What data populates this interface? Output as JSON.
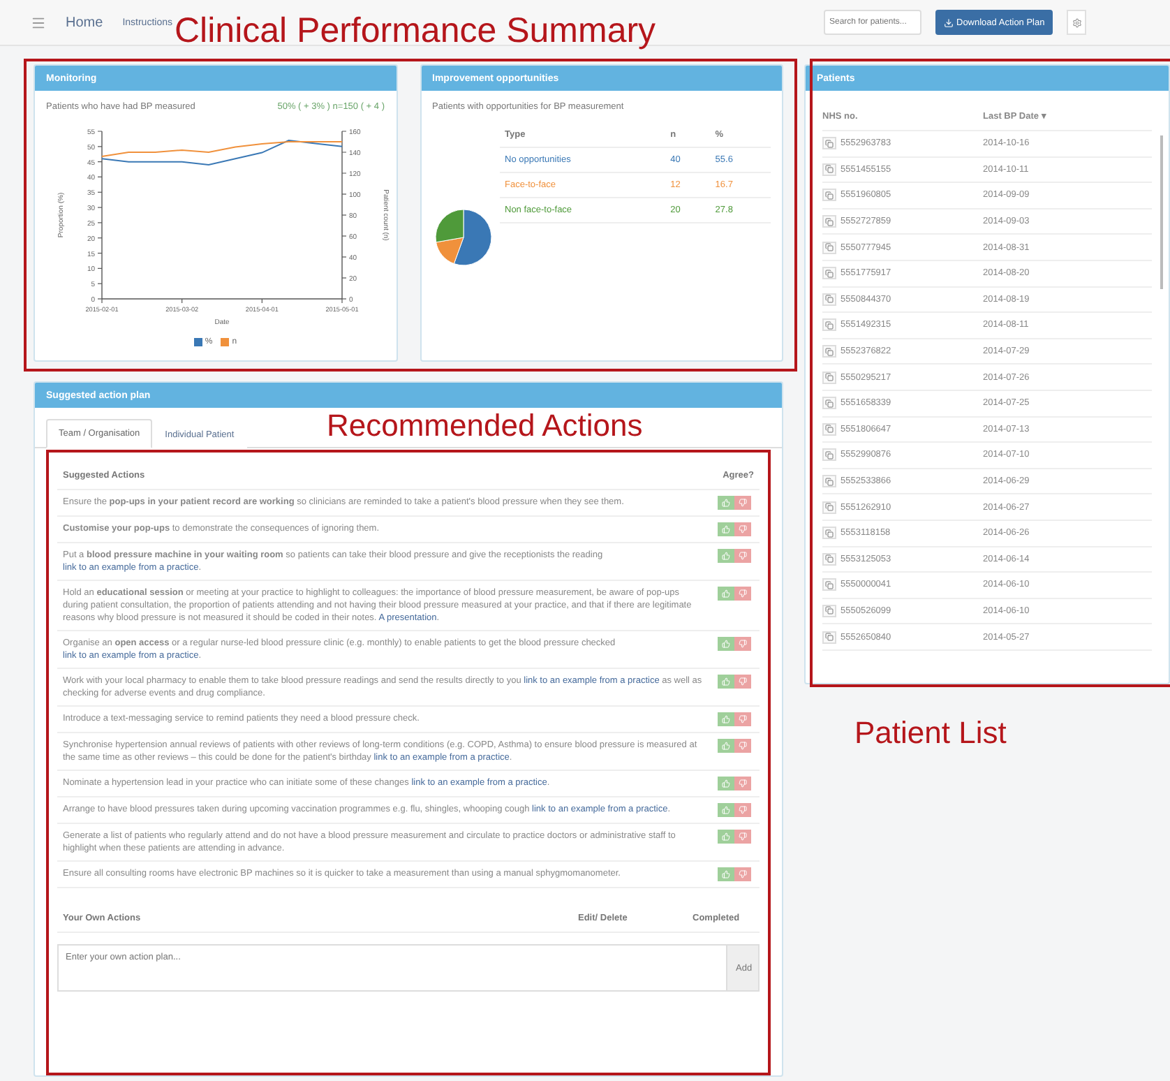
{
  "navbar": {
    "items": [
      "Home",
      "Instructions"
    ],
    "search": {
      "placeholder": "Search for patients..."
    },
    "download_button": "Download Action Plan"
  },
  "annotations": [
    {
      "kind": "summary",
      "label": "Clinical Performance Summary"
    },
    {
      "kind": "actions",
      "label": "Recommended Actions"
    },
    {
      "kind": "patients",
      "label": "Patient List"
    }
  ],
  "monitoring": {
    "title": "Monitoring",
    "subtitle": "Patients who have had BP measured",
    "stat": "50% ( + 3% ) n=150 ( + 4 )",
    "chart_data": {
      "type": "line",
      "xlabel": "Date",
      "ylabel": "Proportion (%)",
      "y2label": "Patient count (n)",
      "categories": [
        "2015-02-01",
        null,
        null,
        "2015-03-02",
        null,
        null,
        "2015-04-01",
        null,
        null,
        "2015-05-01"
      ],
      "ylim": [
        0,
        55
      ],
      "y2lim": [
        0,
        160
      ],
      "yticks": [
        0,
        5,
        10,
        15,
        20,
        25,
        30,
        35,
        40,
        45,
        50,
        55
      ],
      "y2ticks": [
        0,
        20,
        40,
        60,
        80,
        100,
        120,
        140,
        160
      ],
      "series": [
        {
          "name": "%",
          "color": "#3a78b5",
          "values": [
            46,
            45,
            45,
            45,
            44,
            46,
            48,
            52,
            51,
            50
          ]
        },
        {
          "name": "n",
          "color": "#f0913c",
          "axis": "y2",
          "values": [
            136,
            140,
            140,
            142,
            140,
            145,
            148,
            150,
            150,
            150
          ]
        }
      ]
    }
  },
  "improvement": {
    "title": "Improvement opportunities",
    "subtitle": "Patients with opportunities for BP measurement",
    "columns": [
      "Type",
      "n",
      "%"
    ],
    "rows": [
      {
        "type": "No opportunities",
        "n": "40",
        "pct": "55.6",
        "color": "#3a78b5"
      },
      {
        "type": "Face-to-face",
        "n": "12",
        "pct": "16.7",
        "color": "#f0913c"
      },
      {
        "type": "Non face-to-face",
        "n": "20",
        "pct": "27.8",
        "color": "#4f9a3a"
      }
    ],
    "chart_data": {
      "type": "pie",
      "values": [
        55.6,
        16.7,
        27.8
      ]
    }
  },
  "action_plan": {
    "title": "Suggested action plan",
    "tabs": [
      {
        "label": "Team / Organisation",
        "selected": true
      },
      {
        "label": "Individual Patient",
        "selected": false
      }
    ],
    "columns": [
      "Suggested Actions",
      "Agree?"
    ],
    "actions": [
      {
        "text": "Ensure the **pop-ups in your patient record are working** so clinicians are reminded to take a patient's blood pressure when they see them."
      },
      {
        "text": "**Customise your pop-ups** to demonstrate the consequences of ignoring them."
      },
      {
        "text": "Put a **blood pressure machine in your waiting room** so patients can take their blood pressure and give the receptionists the reading",
        "link": "link to an example from a practice",
        "after": "."
      },
      {
        "text": "Hold an **educational session** or meeting at your practice to highlight to colleagues: the importance of blood pressure measurement, be aware of pop-ups during patient consultation, the proportion of patients attending and not having their blood pressure measured at your practice, and that if there are legitimate reasons why blood pressure is not measured it should be coded in their notes.",
        "link": "A presentation",
        "after": "."
      },
      {
        "text": "Organise an **open access** or a regular nurse-led blood pressure clinic (e.g. monthly) to enable patients to get the blood pressure checked",
        "link": "link to an example from a practice",
        "after": "."
      },
      {
        "text": "Work with your local pharmacy to enable them to take blood pressure readings and send the results directly to you",
        "link": "link to an example from a practice",
        "after": " as well as checking for adverse events and drug compliance."
      },
      {
        "text": "Introduce a text-messaging service to remind patients they need a blood pressure check."
      },
      {
        "text": "Synchronise hypertension annual reviews of patients with other reviews of long-term conditions (e.g. COPD, Asthma) to ensure blood pressure is measured at the same time as other reviews – this could be done for the patient's birthday",
        "link": "link to an example from a practice",
        "after": "."
      },
      {
        "text": "Nominate a hypertension lead in your practice who can initiate some of these changes",
        "link": "link to an example from a practice",
        "after": "."
      },
      {
        "text": "Arrange to have blood pressures taken during upcoming vaccination programmes e.g. flu, shingles, whooping cough",
        "link": "link to an example from a practice",
        "after": "."
      },
      {
        "text": "Generate a list of patients who regularly attend and do not have a blood pressure measurement and circulate to practice doctors or administrative staff to highlight when these patients are attending in advance."
      },
      {
        "text": "Ensure all consulting rooms have electronic BP machines so it is quicker to take a measurement than using a manual sphygmomanometer."
      }
    ],
    "own_columns": [
      "Your Own Actions",
      "Edit/ Delete",
      "Completed"
    ],
    "own_input": {
      "placeholder": "Enter your own action plan..."
    },
    "add_button": "Add"
  },
  "patients": {
    "title": "Patients",
    "columns": [
      "NHS no.",
      "Last BP Date ▾"
    ],
    "rows": [
      {
        "nhs": "5552963783",
        "date": "2014-10-16"
      },
      {
        "nhs": "5551455155",
        "date": "2014-10-11"
      },
      {
        "nhs": "5551960805",
        "date": "2014-09-09"
      },
      {
        "nhs": "5552727859",
        "date": "2014-09-03"
      },
      {
        "nhs": "5550777945",
        "date": "2014-08-31"
      },
      {
        "nhs": "5551775917",
        "date": "2014-08-20"
      },
      {
        "nhs": "5550844370",
        "date": "2014-08-19"
      },
      {
        "nhs": "5551492315",
        "date": "2014-08-11"
      },
      {
        "nhs": "5552376822",
        "date": "2014-07-29"
      },
      {
        "nhs": "5550295217",
        "date": "2014-07-26"
      },
      {
        "nhs": "5551658339",
        "date": "2014-07-25"
      },
      {
        "nhs": "5551806647",
        "date": "2014-07-13"
      },
      {
        "nhs": "5552990876",
        "date": "2014-07-10"
      },
      {
        "nhs": "5552533866",
        "date": "2014-06-29"
      },
      {
        "nhs": "5551262910",
        "date": "2014-06-27"
      },
      {
        "nhs": "5553118158",
        "date": "2014-06-26"
      },
      {
        "nhs": "5553125053",
        "date": "2014-06-14"
      },
      {
        "nhs": "5550000041",
        "date": "2014-06-10"
      },
      {
        "nhs": "5550526099",
        "date": "2014-06-10"
      },
      {
        "nhs": "5552650840",
        "date": "2014-05-27"
      }
    ]
  }
}
